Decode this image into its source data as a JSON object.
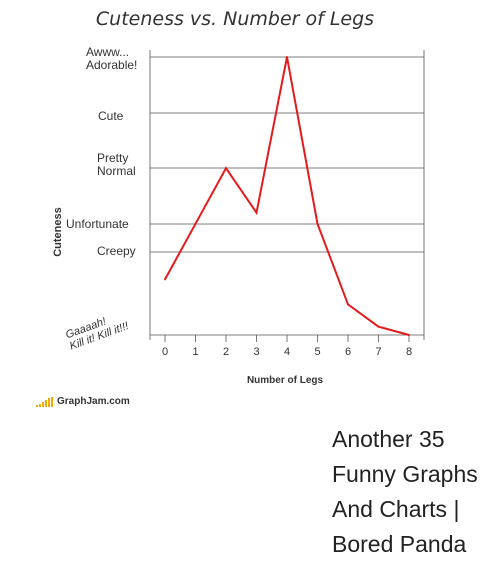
{
  "chart_data": {
    "type": "line",
    "title": "Cuteness vs. Number of Legs",
    "xlabel": "Number of Legs",
    "ylabel": "Cuteness",
    "x": [
      0,
      1,
      2,
      3,
      4,
      5,
      6,
      7,
      8
    ],
    "y_categories": [
      "Gaaaah! Kill it! Kill it!!!",
      "Creepy",
      "Unfortunate",
      "Pretty Normal",
      "Cute",
      "Awww... Adorable!"
    ],
    "series": [
      {
        "color": "#e41a1c",
        "values": [
          1.0,
          2.0,
          3.0,
          2.2,
          5.0,
          2.0,
          0.55,
          0.15,
          0.0
        ]
      }
    ],
    "xlim": [
      0,
      8
    ],
    "ylim": [
      0,
      5
    ],
    "grid": true
  },
  "yticks": {
    "adorable": "Awww...\nAdorable!",
    "cute": "Cute",
    "normal": "Pretty\nNormal",
    "unfortunate": "Unfortunate",
    "creepy": "Creepy",
    "gaaah": "Gaaaah!\nKill it! Kill it!!!"
  },
  "brand": "GraphJam.com",
  "caption": "Another 35 Funny Graphs And Charts | Bored Panda"
}
